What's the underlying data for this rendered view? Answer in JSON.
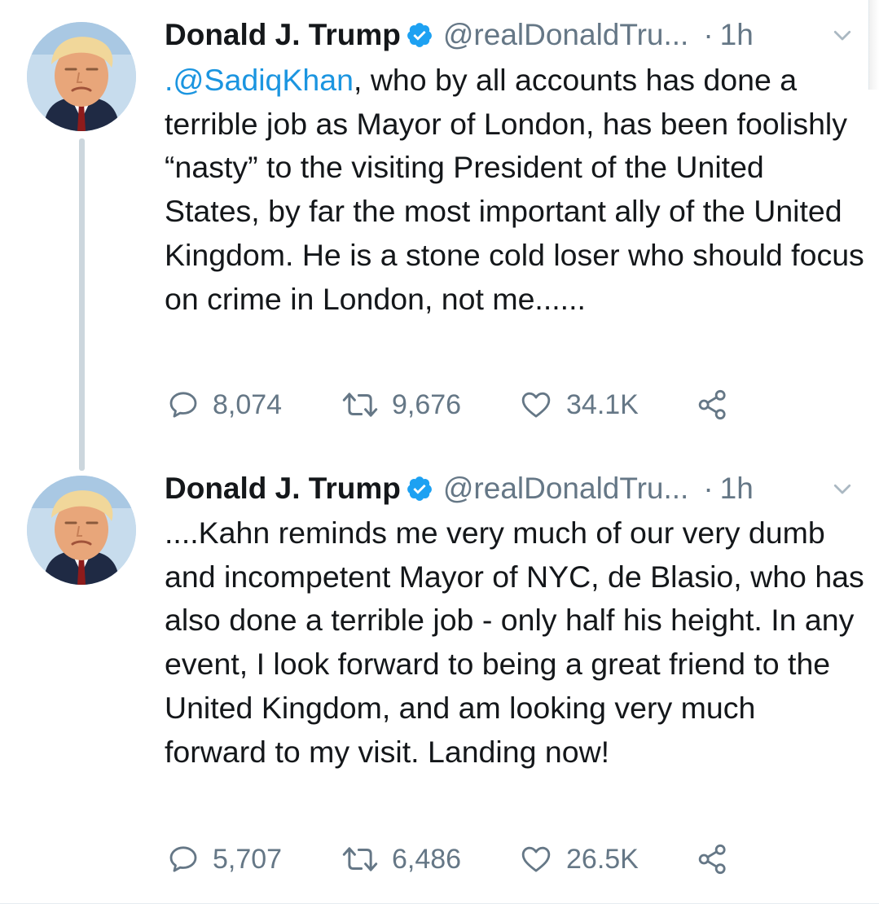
{
  "colors": {
    "text": "#14171a",
    "muted": "#657786",
    "link": "#1b95e0",
    "verified": "#1da1f2",
    "thread_line": "#ccd6dd"
  },
  "tweets": [
    {
      "display_name": "Donald J. Trump",
      "handle": "@realDonaldTru...",
      "separator": "·",
      "time": "1h",
      "mention": ".@SadiqKhan",
      "text": ", who by all accounts has done a terrible job as Mayor of London, has been foolishly “nasty” to the visiting President of the United States, by far the most important ally of the United Kingdom. He is a stone cold loser who should focus on crime in London, not me......",
      "replies": "8,074",
      "retweets": "9,676",
      "likes": "34.1K"
    },
    {
      "display_name": "Donald J. Trump",
      "handle": "@realDonaldTru...",
      "separator": "·",
      "time": "1h",
      "text": "....Kahn reminds me very much of our very dumb and incompetent Mayor of NYC, de Blasio, who has also done a terrible job - only half his height. In any event, I look forward to being a great friend to the United Kingdom, and am looking very much forward to my visit. Landing now!",
      "replies": "5,707",
      "retweets": "6,486",
      "likes": "26.5K"
    }
  ],
  "icons": {
    "avatar": "profile-photo",
    "verified": "verified-badge-icon",
    "caret": "chevron-down-icon",
    "reply": "reply-bubble-icon",
    "retweet": "retweet-arrows-icon",
    "like": "heart-icon",
    "share": "share-nodes-icon"
  }
}
